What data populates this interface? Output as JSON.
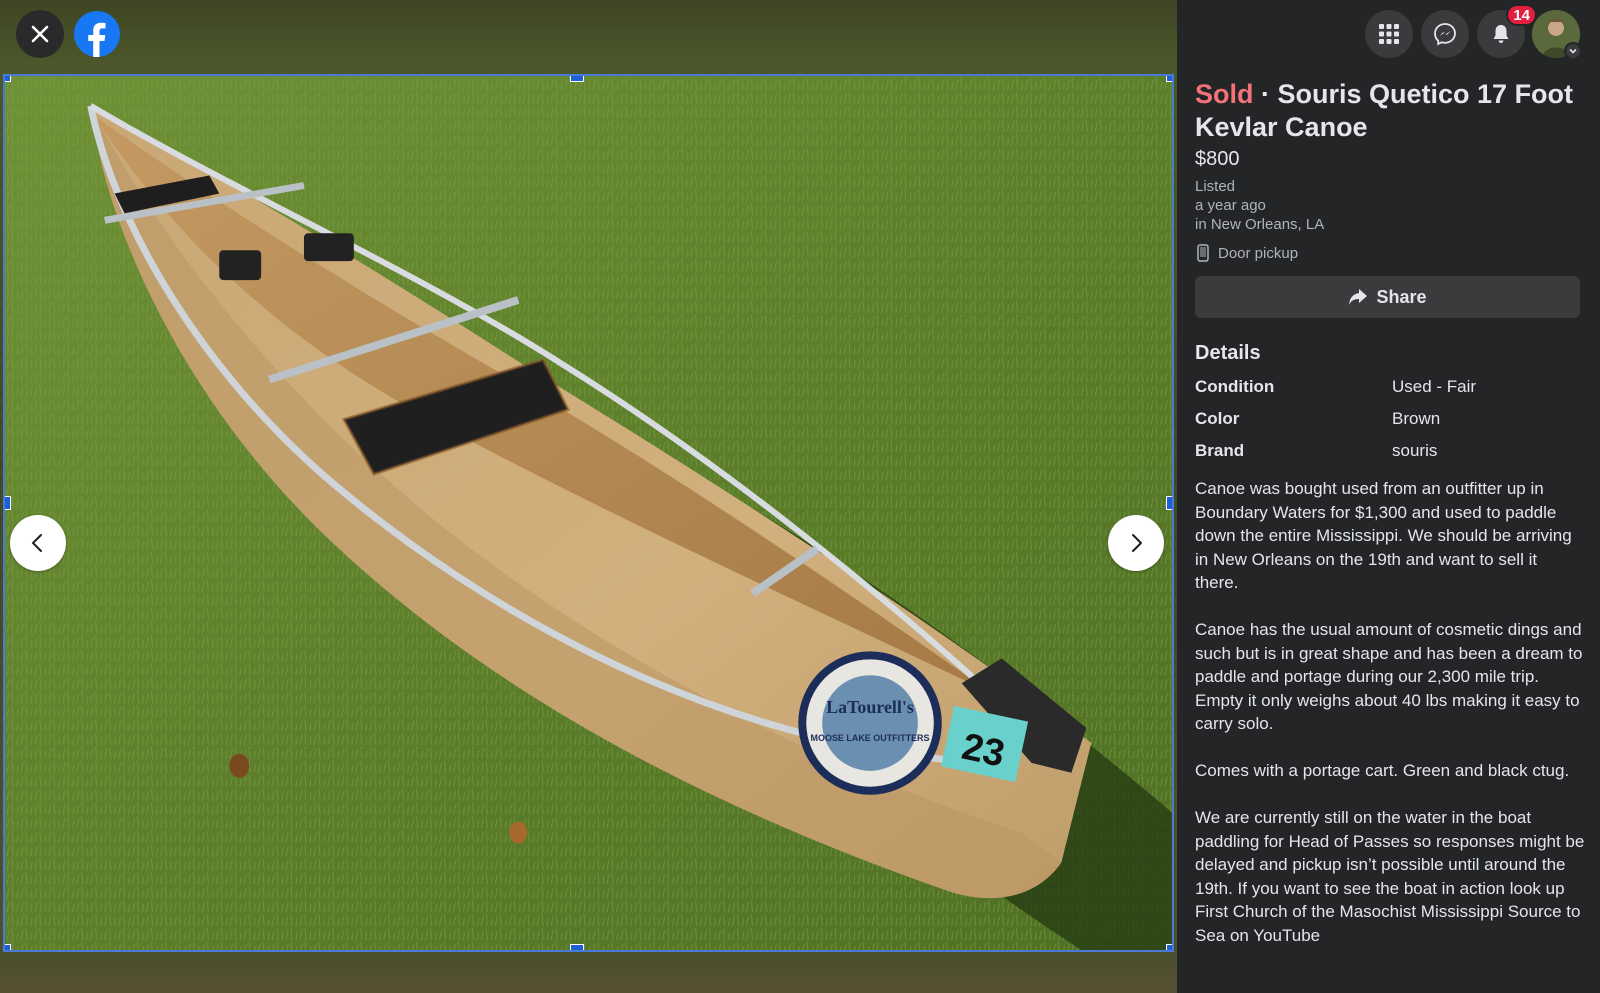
{
  "header": {
    "notifications_count": "14"
  },
  "listing": {
    "status": "Sold",
    "separator": " · ",
    "title": "Souris Quetico 17 Foot Kevlar Canoe",
    "price": "$800",
    "listed_label": "Listed",
    "listed_time": "a year ago",
    "location": "in New Orleans, LA",
    "pickup": "Door pickup",
    "share_label": "Share"
  },
  "details": {
    "heading": "Details",
    "rows": [
      {
        "key": "Condition",
        "value": "Used - Fair"
      },
      {
        "key": "Color",
        "value": "Brown"
      },
      {
        "key": "Brand",
        "value": "souris"
      }
    ],
    "description": [
      "Canoe was bought used from an outfitter up in Boundary Waters for $1,300 and used to paddle down the entire Mississippi. We should be arriving in New Orleans on the 19th and want to sell it there.",
      "Canoe has the usual amount of cosmetic dings and such but is in great shape and has been a dream to paddle and portage during our 2,300 mile trip. Empty it only weighs about 40 lbs making it easy to carry solo.",
      "Comes with a portage cart. Green and black ctug.",
      "We are currently still on the water in the boat paddling for Head of Passes so responses might be delayed and pickup isn’t possible until around the 19th. If you want to see the boat in action look up First Church of the Masochist Mississippi Source to Sea on YouTube"
    ]
  },
  "photo": {
    "sticker_text": "LaTourell's",
    "sticker_subtext": "MOOSE LAKE OUTFITTERS",
    "number_tag": "23"
  },
  "icons": {
    "close": "close-icon",
    "facebook": "facebook-logo",
    "prev": "chevron-left-icon",
    "next": "chevron-right-icon",
    "menu": "grid-menu-icon",
    "messenger": "messenger-icon",
    "notifications": "bell-icon",
    "share": "share-arrow-icon",
    "pickup": "phone-icon"
  },
  "colors": {
    "sold": "#f3727a",
    "panel_bg": "#242526",
    "badge": "#e41e3f",
    "selection": "#1f5fd6"
  }
}
